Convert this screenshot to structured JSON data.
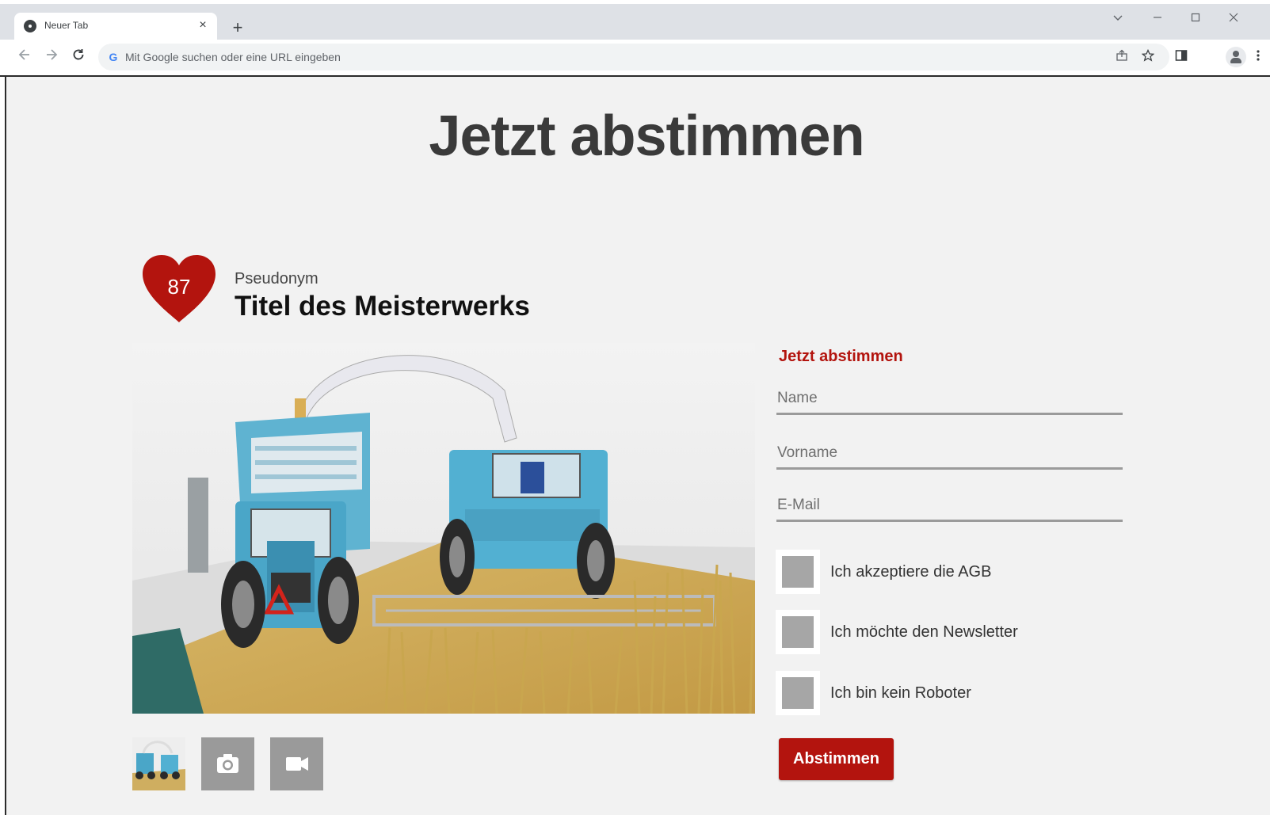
{
  "browser": {
    "tab_title": "Neuer Tab",
    "tab_close": "×",
    "new_tab": "+",
    "omnibox_placeholder": "Mit Google suchen oder eine URL eingeben",
    "g_letter": "G"
  },
  "page": {
    "heading": "Jetzt abstimmen",
    "vote_count": "87",
    "pseudonym": "Pseudonym",
    "work_title": "Titel des Meisterwerks"
  },
  "form": {
    "heading": "Jetzt abstimmen",
    "name_placeholder": "Name",
    "vorname_placeholder": "Vorname",
    "email_placeholder": "E-Mail",
    "checkboxes": [
      {
        "label": "Ich akzeptiere die AGB"
      },
      {
        "label": "Ich möchte den Newsletter"
      },
      {
        "label": "Ich bin kein Roboter"
      }
    ],
    "submit_label": "Abstimmen"
  },
  "colors": {
    "accent": "#b3140e",
    "page_bg": "#f2f2f2",
    "heading": "#3a3a3a",
    "field_line": "#9b9b9b",
    "checkbox_fill": "#a6a6a6"
  },
  "icons": {
    "gallery_photo": "camera-icon",
    "gallery_video": "video-camera-icon",
    "vote": "heart-icon"
  }
}
